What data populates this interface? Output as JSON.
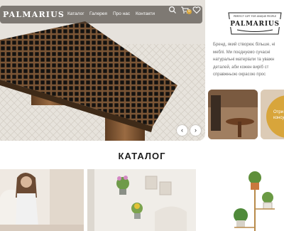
{
  "brand": {
    "name": "PALMARIUS",
    "tagline": "PERFECT GIFT FOR UNIQUE PEOPLE"
  },
  "nav": {
    "items": [
      "Каталог",
      "Галерея",
      "Про нас",
      "Контакти"
    ],
    "cart_count": "0"
  },
  "icons": [
    "search-icon",
    "cart-icon",
    "heart-icon",
    "arrow-left-icon",
    "arrow-right-icon"
  ],
  "hero": {
    "prev": "‹",
    "next": "›"
  },
  "about": {
    "lines": [
      "Бренд, який створює більше, ні",
      "меблі. Ми поєднуємо сучасні",
      "натуральні матеріали та уважн",
      "деталей, аби кожен виріб ст",
      "справжньою окрасою прос"
    ]
  },
  "promo": {
    "line1": "Отри",
    "line2": "консу"
  },
  "catalog": {
    "title": "КАТАЛОГ"
  },
  "colors": {
    "accent": "#d8a53b",
    "dark": "#1e1e1e",
    "text_muted": "#6a6a6a"
  }
}
